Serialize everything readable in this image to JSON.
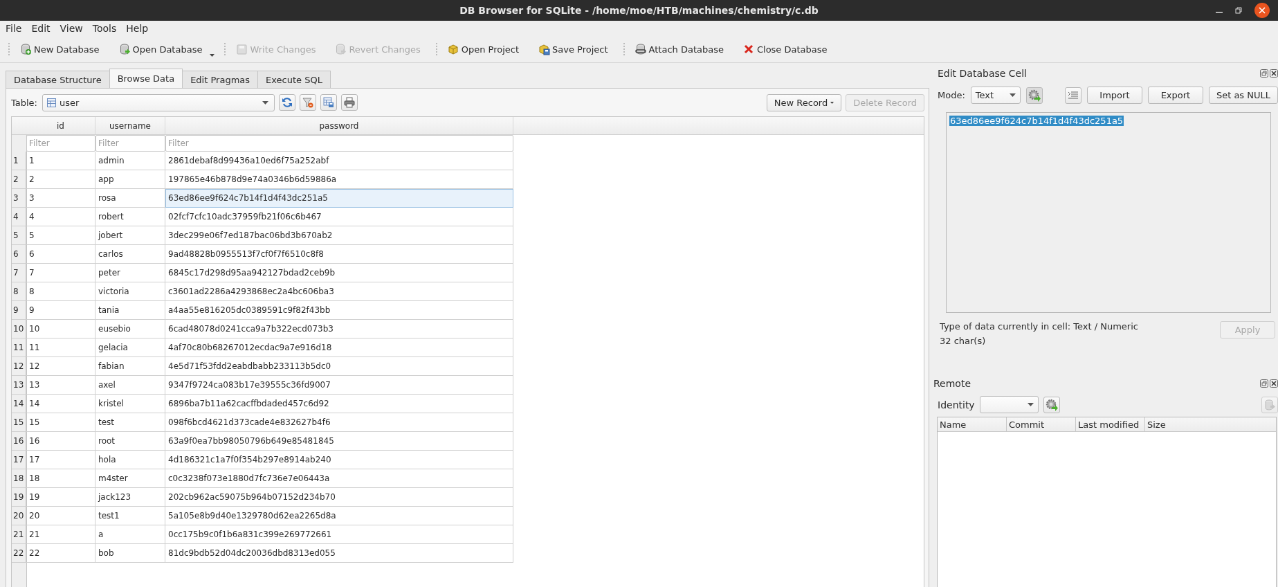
{
  "window": {
    "title": "DB Browser for SQLite - /home/moe/HTB/machines/chemistry/c.db"
  },
  "menu": [
    "File",
    "Edit",
    "View",
    "Tools",
    "Help"
  ],
  "toolbar": [
    {
      "label": "New Database",
      "disabled": false,
      "dropdown": false
    },
    {
      "label": "Open Database",
      "disabled": false,
      "dropdown": true
    },
    {
      "label": "Write Changes",
      "disabled": true,
      "dropdown": false
    },
    {
      "label": "Revert Changes",
      "disabled": true,
      "dropdown": false
    },
    {
      "label": "Open Project",
      "disabled": false,
      "dropdown": false
    },
    {
      "label": "Save Project",
      "disabled": false,
      "dropdown": false
    },
    {
      "label": "Attach Database",
      "disabled": false,
      "dropdown": false
    },
    {
      "label": "Close Database",
      "disabled": false,
      "dropdown": false
    }
  ],
  "tabs": [
    {
      "label": "Database Structure",
      "selected": false
    },
    {
      "label": "Browse Data",
      "selected": true
    },
    {
      "label": "Edit Pragmas",
      "selected": false
    },
    {
      "label": "Execute SQL",
      "selected": false
    }
  ],
  "browse": {
    "table_label": "Table:",
    "table": "user",
    "new_record": {
      "label": "New Record",
      "disabled": false
    },
    "delete_record": {
      "label": "Delete Record",
      "disabled": true
    },
    "columns": [
      "id",
      "username",
      "password"
    ],
    "filters": [
      {
        "placeholder": "Filter"
      },
      {
        "placeholder": "Filter"
      },
      {
        "placeholder": "Filter"
      }
    ],
    "rows": [
      {
        "number": "1",
        "cells": [
          {
            "text": "1",
            "selected": false
          },
          {
            "text": "admin",
            "selected": false
          },
          {
            "text": "2861debaf8d99436a10ed6f75a252abf",
            "selected": false
          }
        ]
      },
      {
        "number": "2",
        "cells": [
          {
            "text": "2",
            "selected": false
          },
          {
            "text": "app",
            "selected": false
          },
          {
            "text": "197865e46b878d9e74a0346b6d59886a",
            "selected": false
          }
        ]
      },
      {
        "number": "3",
        "cells": [
          {
            "text": "3",
            "selected": false
          },
          {
            "text": "rosa",
            "selected": false
          },
          {
            "text": "63ed86ee9f624c7b14f1d4f43dc251a5",
            "selected": true
          }
        ]
      },
      {
        "number": "4",
        "cells": [
          {
            "text": "4",
            "selected": false
          },
          {
            "text": "robert",
            "selected": false
          },
          {
            "text": "02fcf7cfc10adc37959fb21f06c6b467",
            "selected": false
          }
        ]
      },
      {
        "number": "5",
        "cells": [
          {
            "text": "5",
            "selected": false
          },
          {
            "text": "jobert",
            "selected": false
          },
          {
            "text": "3dec299e06f7ed187bac06bd3b670ab2",
            "selected": false
          }
        ]
      },
      {
        "number": "6",
        "cells": [
          {
            "text": "6",
            "selected": false
          },
          {
            "text": "carlos",
            "selected": false
          },
          {
            "text": "9ad48828b0955513f7cf0f7f6510c8f8",
            "selected": false
          }
        ]
      },
      {
        "number": "7",
        "cells": [
          {
            "text": "7",
            "selected": false
          },
          {
            "text": "peter",
            "selected": false
          },
          {
            "text": "6845c17d298d95aa942127bdad2ceb9b",
            "selected": false
          }
        ]
      },
      {
        "number": "8",
        "cells": [
          {
            "text": "8",
            "selected": false
          },
          {
            "text": "victoria",
            "selected": false
          },
          {
            "text": "c3601ad2286a4293868ec2a4bc606ba3",
            "selected": false
          }
        ]
      },
      {
        "number": "9",
        "cells": [
          {
            "text": "9",
            "selected": false
          },
          {
            "text": "tania",
            "selected": false
          },
          {
            "text": "a4aa55e816205dc0389591c9f82f43bb",
            "selected": false
          }
        ]
      },
      {
        "number": "10",
        "cells": [
          {
            "text": "10",
            "selected": false
          },
          {
            "text": "eusebio",
            "selected": false
          },
          {
            "text": "6cad48078d0241cca9a7b322ecd073b3",
            "selected": false
          }
        ]
      },
      {
        "number": "11",
        "cells": [
          {
            "text": "11",
            "selected": false
          },
          {
            "text": "gelacia",
            "selected": false
          },
          {
            "text": "4af70c80b68267012ecdac9a7e916d18",
            "selected": false
          }
        ]
      },
      {
        "number": "12",
        "cells": [
          {
            "text": "12",
            "selected": false
          },
          {
            "text": "fabian",
            "selected": false
          },
          {
            "text": "4e5d71f53fdd2eabdbabb233113b5dc0",
            "selected": false
          }
        ]
      },
      {
        "number": "13",
        "cells": [
          {
            "text": "13",
            "selected": false
          },
          {
            "text": "axel",
            "selected": false
          },
          {
            "text": "9347f9724ca083b17e39555c36fd9007",
            "selected": false
          }
        ]
      },
      {
        "number": "14",
        "cells": [
          {
            "text": "14",
            "selected": false
          },
          {
            "text": "kristel",
            "selected": false
          },
          {
            "text": "6896ba7b11a62cacffbdaded457c6d92",
            "selected": false
          }
        ]
      },
      {
        "number": "15",
        "cells": [
          {
            "text": "15",
            "selected": false
          },
          {
            "text": "test",
            "selected": false
          },
          {
            "text": "098f6bcd4621d373cade4e832627b4f6",
            "selected": false
          }
        ]
      },
      {
        "number": "16",
        "cells": [
          {
            "text": "16",
            "selected": false
          },
          {
            "text": "root",
            "selected": false
          },
          {
            "text": "63a9f0ea7bb98050796b649e85481845",
            "selected": false
          }
        ]
      },
      {
        "number": "17",
        "cells": [
          {
            "text": "17",
            "selected": false
          },
          {
            "text": "hola",
            "selected": false
          },
          {
            "text": "4d186321c1a7f0f354b297e8914ab240",
            "selected": false
          }
        ]
      },
      {
        "number": "18",
        "cells": [
          {
            "text": "18",
            "selected": false
          },
          {
            "text": "m4ster",
            "selected": false
          },
          {
            "text": "c0c3238f073e1880d7fc736e7e06443a",
            "selected": false
          }
        ]
      },
      {
        "number": "19",
        "cells": [
          {
            "text": "19",
            "selected": false
          },
          {
            "text": "jack123",
            "selected": false
          },
          {
            "text": "202cb962ac59075b964b07152d234b70",
            "selected": false
          }
        ]
      },
      {
        "number": "20",
        "cells": [
          {
            "text": "20",
            "selected": false
          },
          {
            "text": "test1",
            "selected": false
          },
          {
            "text": "5a105e8b9d40e1329780d62ea2265d8a",
            "selected": false
          }
        ]
      },
      {
        "number": "21",
        "cells": [
          {
            "text": "21",
            "selected": false
          },
          {
            "text": "a",
            "selected": false
          },
          {
            "text": "0cc175b9c0f1b6a831c399e269772661",
            "selected": false
          }
        ]
      },
      {
        "number": "22",
        "cells": [
          {
            "text": "22",
            "selected": false
          },
          {
            "text": "bob",
            "selected": false
          },
          {
            "text": "81dc9bdb52d04dc20036dbd8313ed055",
            "selected": false
          }
        ]
      }
    ]
  },
  "edit_cell": {
    "title": "Edit Database Cell",
    "mode_label": "Mode:",
    "mode": "Text",
    "buttons": [
      {
        "label": "Import"
      },
      {
        "label": "Export"
      },
      {
        "label": "Set as NULL"
      }
    ],
    "value": "63ed86ee9f624c7b14f1d4f43dc251a5",
    "value_selected": true,
    "type_info": "Type of data currently in cell: Text / Numeric",
    "length": "32 char(s)",
    "apply": {
      "label": "Apply",
      "disabled": true
    }
  },
  "remote": {
    "title": "Remote",
    "identity_label": "Identity",
    "columns": [
      "Name",
      "Commit",
      "Last modified",
      "Size"
    ]
  }
}
